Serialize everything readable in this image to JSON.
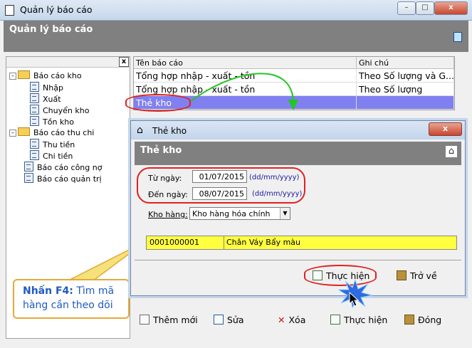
{
  "window": {
    "title": "Quản lý báo cáo",
    "header": "Quản lý báo cáo",
    "controls": [
      "–",
      "□",
      "x"
    ]
  },
  "tree": {
    "items": [
      {
        "label": "Báo cáo kho",
        "type": "folder",
        "expander": "–"
      },
      {
        "label": "Nhập",
        "type": "report"
      },
      {
        "label": "Xuất",
        "type": "report"
      },
      {
        "label": "Chuyển kho",
        "type": "report"
      },
      {
        "label": "Tồn kho",
        "type": "report"
      },
      {
        "label": "Báo cáo thu chi",
        "type": "folder",
        "expander": "–"
      },
      {
        "label": "Thu tiền",
        "type": "report"
      },
      {
        "label": "Chi tiền",
        "type": "report"
      },
      {
        "label": "Báo cáo công nợ",
        "type": "report"
      },
      {
        "label": "Báo cáo quản trị",
        "type": "report"
      }
    ],
    "close_glyph": "x"
  },
  "grid": {
    "columns": [
      "Tên báo cáo",
      "Ghi chú"
    ],
    "rows": [
      [
        "Tổng hợp nhập - xuất - tồn",
        "Theo Số lượng và G..."
      ],
      [
        "Tổng hợp nhập - xuất - tồn",
        "Theo Số lượng"
      ],
      [
        "Thẻ kho",
        ""
      ]
    ],
    "selected_row": 2
  },
  "dialog": {
    "title": "Thẻ kho",
    "header": "Thẻ kho",
    "from_label": "Từ ngày:",
    "from_value": "01/07/2015",
    "to_label": "Đến ngày:",
    "to_value": "08/07/2015",
    "date_hint": "(dd/mm/yyyy)",
    "warehouse_label": "Kho hàng:",
    "warehouse_value": "Kho hàng hóa chính",
    "item_code": "0001000001",
    "item_name": "Chân Váy Bẩy màu",
    "run_label": "Thực hiện",
    "back_label": "Trở về",
    "close_glyph": "x"
  },
  "toolbar": {
    "add_label": "Thêm mới",
    "edit_label": "Sửa",
    "delete_label": "Xóa",
    "run_label": "Thực hiện",
    "close_label": "Đóng"
  },
  "callout": {
    "key": "Nhấn F4:",
    "line1": " Tìm mã",
    "line2": "hàng cần theo dõi"
  },
  "colors": {
    "header_bg": "#808080",
    "selected_row": "#8080f0",
    "item_row": "#ffff40",
    "annotation": "#e02020",
    "arrow": "#20c820"
  }
}
